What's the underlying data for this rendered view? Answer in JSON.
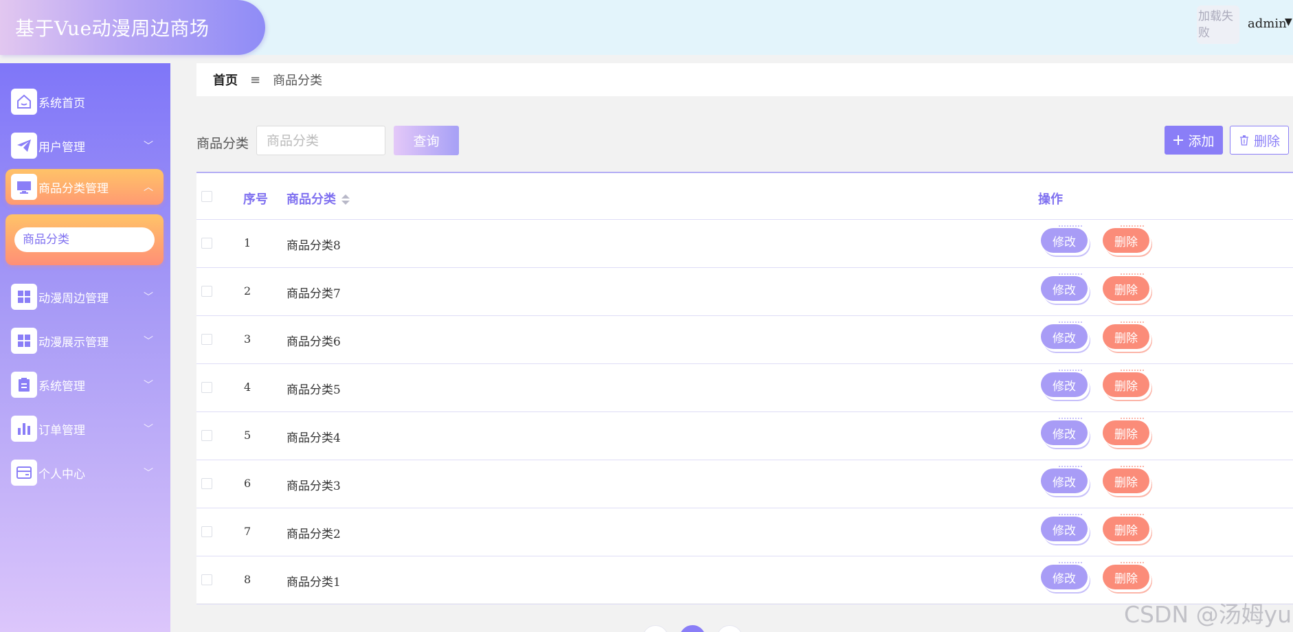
{
  "header": {
    "title": "基于Vue动漫周边商场",
    "avatar_alt": "加载失败",
    "username": "admin",
    "caret": "▼"
  },
  "sidebar": {
    "items": [
      {
        "label": "系统首页",
        "icon": "home-icon",
        "caret": ""
      },
      {
        "label": "用户管理",
        "icon": "paper-plane-icon",
        "caret": "﹀"
      },
      {
        "label": "商品分类管理",
        "icon": "monitor-icon",
        "caret": "︿"
      },
      {
        "label": "动漫周边管理",
        "icon": "grid-icon",
        "caret": "﹀"
      },
      {
        "label": "动漫展示管理",
        "icon": "grid-icon",
        "caret": "﹀"
      },
      {
        "label": "系统管理",
        "icon": "clipboard-icon",
        "caret": "﹀"
      },
      {
        "label": "订单管理",
        "icon": "bar-chart-icon",
        "caret": "﹀"
      },
      {
        "label": "个人中心",
        "icon": "card-icon",
        "caret": "﹀"
      }
    ],
    "submenu": {
      "label": "商品分类"
    }
  },
  "breadcrumb": {
    "home": "首页",
    "separator": "≡",
    "current": "商品分类"
  },
  "search": {
    "label": "商品分类",
    "placeholder": "商品分类",
    "query_label": "查询"
  },
  "toolbar": {
    "add_label": "添加",
    "delete_label": "删除"
  },
  "table": {
    "columns": [
      "序号",
      "商品分类",
      "操作"
    ],
    "rows": [
      {
        "index": "1",
        "name": "商品分类8"
      },
      {
        "index": "2",
        "name": "商品分类7"
      },
      {
        "index": "3",
        "name": "商品分类6"
      },
      {
        "index": "4",
        "name": "商品分类5"
      },
      {
        "index": "5",
        "name": "商品分类4"
      },
      {
        "index": "6",
        "name": "商品分类3"
      },
      {
        "index": "7",
        "name": "商品分类2"
      },
      {
        "index": "8",
        "name": "商品分类1"
      }
    ],
    "edit_label": "修改",
    "delete_label": "删除"
  },
  "watermark": "CSDN @汤姆yu",
  "colors": {
    "accent": "#8a7ef7",
    "danger": "#fb8c79",
    "active_menu": "#ffb26e"
  }
}
